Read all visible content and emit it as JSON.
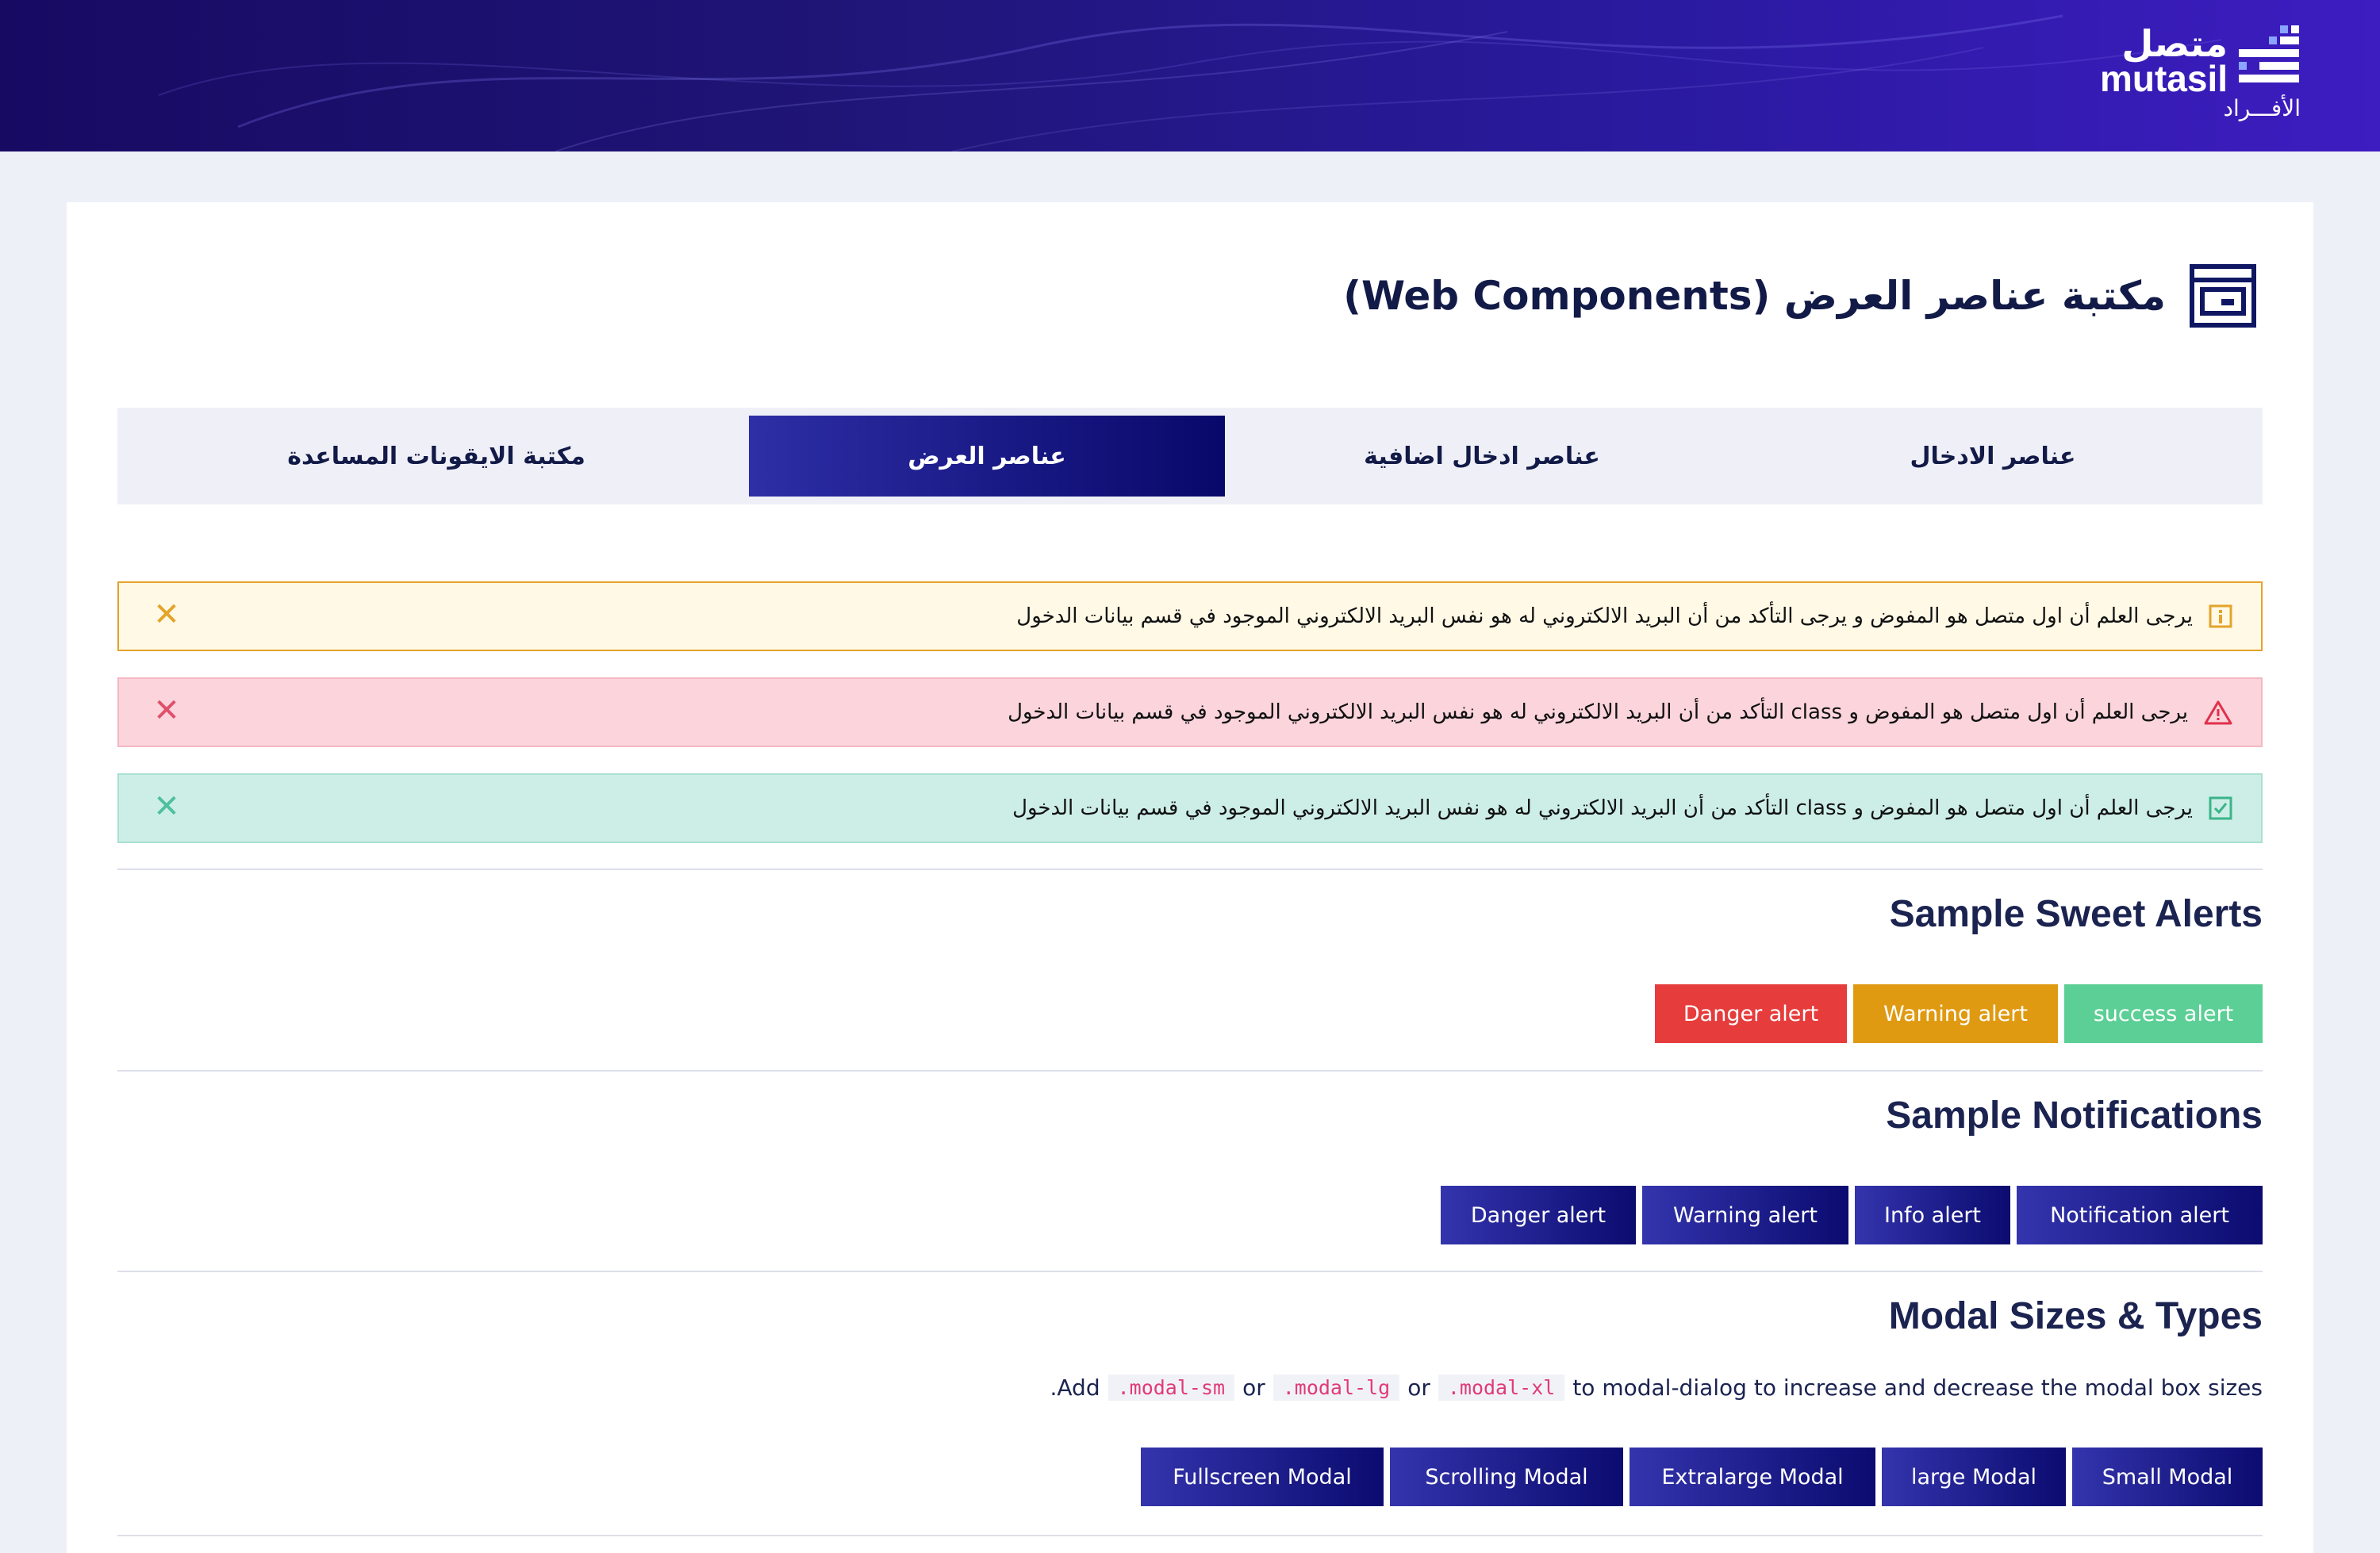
{
  "brand": {
    "name_ar": "متصل",
    "name_en": "mutasil",
    "section": "الأفـــراد"
  },
  "page": {
    "title": "مكتبة عناصر العرض (Web Components)",
    "icon": "web-components-icon"
  },
  "tabs": [
    {
      "label": "عناصر الادخال",
      "active": false
    },
    {
      "label": "عناصر ادخال اضافية",
      "active": false
    },
    {
      "label": "عناصر العرض",
      "active": true
    },
    {
      "label": "مكتبة الايقونات المساعدة",
      "active": false
    }
  ],
  "alerts": {
    "warning": {
      "text": "يرجى العلم أن اول متصل هو المفوض و يرجى التأكد من أن البريد الالكتروني له هو نفس البريد الالكتروني الموجود في قسم بيانات الدخول",
      "icon": "info-icon",
      "close": "✕",
      "color": "#e4a42a"
    },
    "danger": {
      "text": "يرجى العلم أن اول متصل هو المفوض و class التأكد من أن البريد الالكتروني له هو نفس البريد الالكتروني الموجود في قسم بيانات الدخول",
      "icon": "warning-triangle-icon",
      "close": "✕",
      "color": "#e0506a"
    },
    "success": {
      "text": "يرجى العلم أن اول متصل هو المفوض و class التأكد من أن البريد الالكتروني له هو نفس البريد الالكتروني الموجود في قسم بيانات الدخول",
      "icon": "check-square-icon",
      "close": "✕",
      "color": "#4fbf9c"
    }
  },
  "sweet_alerts": {
    "title": "Sample Sweet Alerts",
    "buttons": {
      "success": "success alert",
      "warning": "Warning alert",
      "danger": "Danger alert"
    }
  },
  "notifications": {
    "title": "Sample Notifications",
    "buttons": {
      "notification": "Notification alert",
      "info": "Info alert",
      "warning": "Warning alert",
      "danger": "Danger alert"
    }
  },
  "modals": {
    "title": "Modal Sizes & Types",
    "desc_prefix": "to modal-dialog to increase and decrease the modal box sizes",
    "code_xl": ".modal-xl",
    "or_1": "or",
    "code_lg": ".modal-lg",
    "or_2": "or",
    "code_sm": ".modal-sm",
    "desc_suffix": ".Add",
    "buttons": {
      "small": "Small Modal",
      "large": "large Modal",
      "extralarge": "Extralarge Modal",
      "scrolling": "Scrolling Modal",
      "fullscreen": "Fullscreen Modal"
    }
  },
  "colors": {
    "navy": "#121a47",
    "brand_gradient_start": "#170a63",
    "brand_gradient_end": "#3d1cc0",
    "success": "#5bcf95",
    "warning": "#df9a12",
    "danger": "#e63c3c"
  }
}
